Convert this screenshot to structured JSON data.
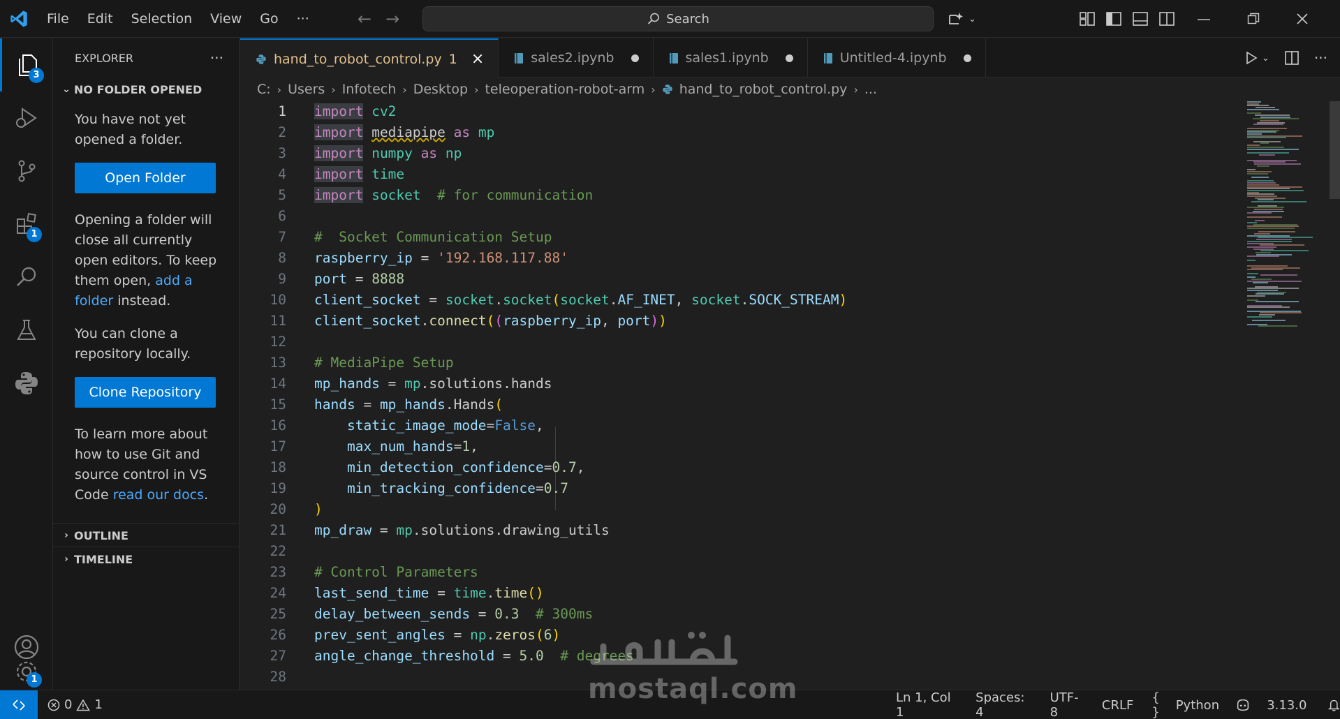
{
  "menu": [
    "File",
    "Edit",
    "Selection",
    "View",
    "Go",
    "···"
  ],
  "search": {
    "label": "Search"
  },
  "activity_badges": {
    "explorer": "3",
    "extensions": "1",
    "settings": "1"
  },
  "sidebar": {
    "title": "EXPLORER",
    "more": "···",
    "section": "NO FOLDER OPENED",
    "msg1": "You have not yet opened a folder.",
    "open_folder": "Open Folder",
    "msg2_a": "Opening a folder will close all currently open editors. To keep them open, ",
    "msg2_link": "add a folder",
    "msg2_b": " instead.",
    "msg3": "You can clone a repository locally.",
    "clone": "Clone Repository",
    "msg4_a": "To learn more about how to use Git and source control in VS Code ",
    "msg4_link": "read our docs",
    "msg4_b": ".",
    "outline": "OUTLINE",
    "timeline": "TIMELINE"
  },
  "tabs": [
    {
      "label": "hand_to_robot_control.py",
      "mod": "1",
      "active": true
    },
    {
      "label": "sales2.ipynb"
    },
    {
      "label": "sales1.ipynb"
    },
    {
      "label": "Untitled-4.ipynb"
    }
  ],
  "breadcrumb": [
    "C:",
    "Users",
    "Infotech",
    "Desktop",
    "teleoperation-robot-arm",
    "hand_to_robot_control.py",
    "..."
  ],
  "code": {
    "ln": [
      "1",
      "2",
      "3",
      "4",
      "5",
      "6",
      "7",
      "8",
      "9",
      "10",
      "11",
      "12",
      "13",
      "14",
      "15",
      "16",
      "17",
      "18",
      "19",
      "20",
      "21",
      "22",
      "23",
      "24",
      "25",
      "26",
      "27",
      "28"
    ],
    "import": "import",
    "as": "as",
    "cv2": "cv2",
    "mediapipe": "mediapipe",
    "mp": "mp",
    "numpy": "numpy",
    "np": "np",
    "time": "time",
    "socket": "socket",
    "c_comm": "# for communication",
    "c_socket": "#  Socket Communication Setup",
    "raspberry_ip": "raspberry_ip",
    "eq": " = ",
    "ip_val": "'192.168.117.88'",
    "port": "port",
    "port_val": "8888",
    "client_socket": "client_socket",
    "dot": ".",
    "AF_INET": "AF_INET",
    "SOCK_STREAM": "SOCK_STREAM",
    "comma": ", ",
    "connect": "connect",
    "c_mp": "# MediaPipe Setup",
    "mp_hands": "mp_hands",
    "solutions": "solutions",
    "hands": "hands",
    "Hands": "Hands",
    "static_image_mode": "static_image_mode",
    "False": "False",
    "max_num_hands": "max_num_hands",
    "one": "1",
    "min_detection_confidence": "min_detection_confidence",
    "min_tracking_confidence": "min_tracking_confidence",
    "p7": "0.7",
    "mp_draw": "mp_draw",
    "drawing_utils": "drawing_utils",
    "c_ctrl": "# Control Parameters",
    "last_send_time": "last_send_time",
    "delay_between_sends": "delay_between_sends",
    "p3": "0.3",
    "c_300": "# 300ms",
    "prev_sent_angles": "prev_sent_angles",
    "zeros": "zeros",
    "six": "6",
    "angle_change_threshold": "angle_change_threshold",
    "five": "5.0",
    "c_deg": "# degrees"
  },
  "status": {
    "errors": "0",
    "warnings": "1",
    "position": "Ln 1, Col 1",
    "spaces": "Spaces: 4",
    "encoding": "UTF-8",
    "eol": "CRLF",
    "braces": "{ }",
    "language": "Python",
    "version": "3.13.0"
  },
  "watermark": {
    "arabic": "مستقل",
    "latin": "mostaql.com"
  },
  "colors": {
    "accent": "#0078d4",
    "bg": "#1f1f1f",
    "sidebar_bg": "#181818"
  }
}
